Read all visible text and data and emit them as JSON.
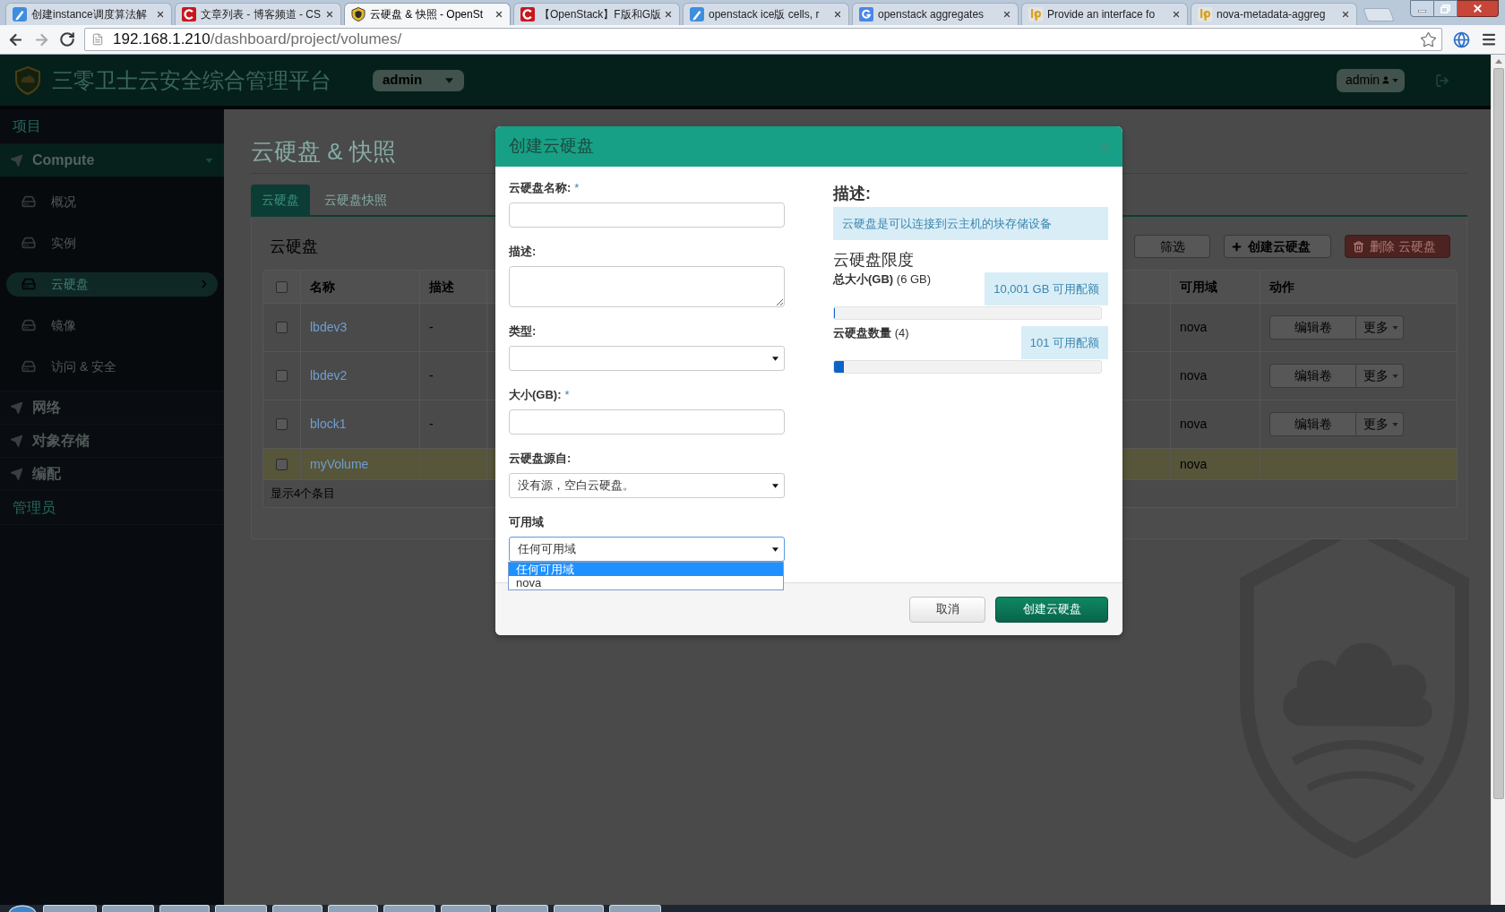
{
  "browser": {
    "tabs": [
      {
        "title": "创建instance调度算法解",
        "kind": "pen",
        "selected": false
      },
      {
        "title": "文章列表 - 博客频道 - CS",
        "kind": "ring",
        "selected": false
      },
      {
        "title": "云硬盘 & 快照 - OpenSt",
        "kind": "shield",
        "selected": true
      },
      {
        "title": "【OpenStack】F版和G版",
        "kind": "ring",
        "selected": false
      },
      {
        "title": "openstack ice版 cells, r",
        "kind": "pen",
        "selected": false
      },
      {
        "title": "openstack aggregates",
        "kind": "hook",
        "selected": false
      },
      {
        "title": "Provide an interface fo",
        "kind": "bars",
        "selected": false
      },
      {
        "title": "nova-metadata-aggreg",
        "kind": "bars",
        "selected": false
      }
    ],
    "address_bar": {
      "host": "192.168.1.210",
      "path": "/dashboard/project/volumes/"
    }
  },
  "header": {
    "brand": "三零卫士云安全综合管理平台",
    "project_menu": "admin",
    "user_menu": "admin"
  },
  "sidebar": {
    "section": "项目",
    "groups": [
      {
        "label": "Compute",
        "expanded": true,
        "children": [
          {
            "label": "概况",
            "selected": false
          },
          {
            "label": "实例",
            "selected": false
          },
          {
            "label": "云硬盘",
            "selected": true
          },
          {
            "label": "镜像",
            "selected": false
          },
          {
            "label": "访问 & 安全",
            "selected": false
          }
        ]
      },
      {
        "label": "网络",
        "expanded": false
      },
      {
        "label": "对象存储",
        "expanded": false
      },
      {
        "label": "编配",
        "expanded": false
      }
    ],
    "admin_section": "管理员"
  },
  "page": {
    "title": "云硬盘 & 快照",
    "tabs": [
      {
        "label": "云硬盘",
        "selected": true
      },
      {
        "label": "云硬盘快照",
        "selected": false
      }
    ],
    "table": {
      "title": "云硬盘",
      "actions": [
        {
          "label": "筛选",
          "kind": "filter"
        },
        {
          "label": "创建云硬盘",
          "kind": "create"
        },
        {
          "label": "删除 云硬盘",
          "kind": "delete"
        }
      ],
      "select_all": {
        "checked": false
      },
      "columns": [
        {
          "label": "名称"
        },
        {
          "label": "描述"
        },
        {
          "label": "可用域"
        },
        {
          "label": "动作"
        }
      ],
      "rows": [
        {
          "name": "lbdev3",
          "description": "-",
          "zone": "nova",
          "checked": false,
          "highlighted": false,
          "actions": [
            {
              "label": "编辑卷",
              "kind": "edit"
            },
            {
              "label": "更多",
              "kind": "more"
            }
          ]
        },
        {
          "name": "lbdev2",
          "description": "-",
          "zone": "nova",
          "checked": false,
          "highlighted": false,
          "actions": [
            {
              "label": "编辑卷",
              "kind": "edit"
            },
            {
              "label": "更多",
              "kind": "more"
            }
          ]
        },
        {
          "name": "block1",
          "description": "-",
          "zone": "nova",
          "checked": false,
          "highlighted": false,
          "actions": [
            {
              "label": "编辑卷",
              "kind": "edit"
            },
            {
              "label": "更多",
              "kind": "more"
            }
          ]
        },
        {
          "name": "myVolume",
          "zone": "nova",
          "checked": false,
          "highlighted": true
        }
      ],
      "footer": "显示4个条目"
    }
  },
  "modal": {
    "title": "创建云硬盘",
    "fields": [
      {
        "label": "云硬盘名称:",
        "required_mark": "*",
        "kind": "text",
        "focused": false
      },
      {
        "label": "描述:",
        "kind": "textarea",
        "focused": false
      },
      {
        "label": "类型:",
        "kind": "select",
        "focused": false
      },
      {
        "label": "大小(GB):",
        "required_mark": "*",
        "kind": "text",
        "focused": false
      },
      {
        "label": "云硬盘源自:",
        "kind": "select",
        "value": "没有源，空白云硬盘。",
        "focused": false
      },
      {
        "label": "可用域",
        "kind": "select",
        "value": "任何可用域",
        "focused": true,
        "options": [
          {
            "label": "任何可用域",
            "selected": true
          },
          {
            "label": "nova",
            "selected": false
          }
        ]
      }
    ],
    "info": {
      "heading": "描述:",
      "text": "云硬盘是可以连接到云主机的块存储设备"
    },
    "quota": {
      "heading": "云硬盘限度",
      "items": [
        {
          "label": "总大小(GB)",
          "used": "(6 GB)",
          "available": "10,001 GB 可用配额",
          "level": 0.0006
        },
        {
          "label": "云硬盘数量",
          "used": "(4)",
          "available": "101 可用配额",
          "level": 0.038
        }
      ]
    },
    "buttons": [
      {
        "label": "取消",
        "kind": "cancel"
      },
      {
        "label": "创建云硬盘",
        "kind": "submit"
      }
    ]
  }
}
